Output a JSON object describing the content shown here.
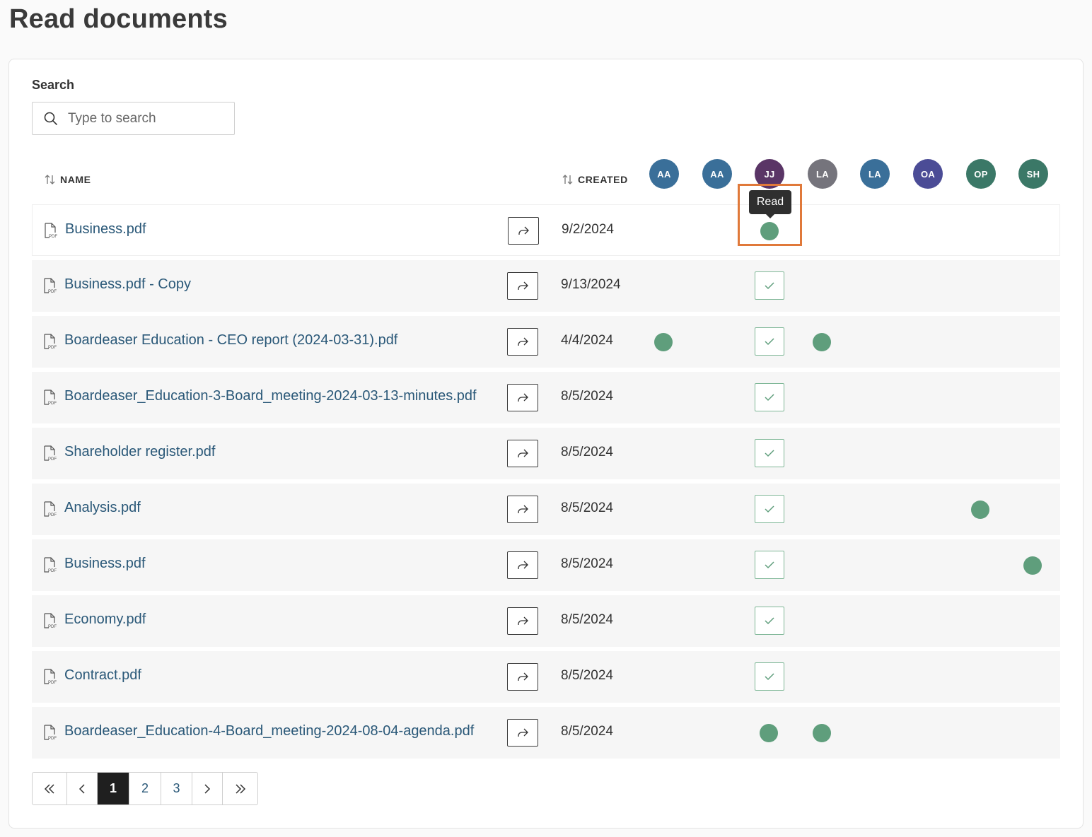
{
  "page": {
    "title": "Read documents"
  },
  "search": {
    "label": "Search",
    "placeholder": "Type to search",
    "value": ""
  },
  "columns": {
    "name": "NAME",
    "created": "CREATED"
  },
  "readers": [
    {
      "initials": "AA",
      "color": "#3a6f99"
    },
    {
      "initials": "AA",
      "color": "#3a6f99"
    },
    {
      "initials": "JJ",
      "color": "#5a3566"
    },
    {
      "initials": "LA",
      "color": "#75747c"
    },
    {
      "initials": "LA",
      "color": "#3a6f99"
    },
    {
      "initials": "OA",
      "color": "#4b4c96"
    },
    {
      "initials": "OP",
      "color": "#3b7867"
    },
    {
      "initials": "SH",
      "color": "#3b7867"
    }
  ],
  "tooltip": {
    "text": "Read"
  },
  "documents": [
    {
      "name": "Business.pdf",
      "created": "9/2/2024"
    },
    {
      "name": "Business.pdf - Copy",
      "created": "9/13/2024"
    },
    {
      "name": "Boardeaser Education - CEO report (2024-03-31).pdf",
      "created": "4/4/2024"
    },
    {
      "name": "Boardeaser_Education-3-Board_meeting-2024-03-13-minutes.pdf",
      "created": "8/5/2024"
    },
    {
      "name": "Shareholder register.pdf",
      "created": "8/5/2024"
    },
    {
      "name": "Analysis.pdf",
      "created": "8/5/2024"
    },
    {
      "name": "Business.pdf",
      "created": "8/5/2024"
    },
    {
      "name": "Economy.pdf",
      "created": "8/5/2024"
    },
    {
      "name": "Contract.pdf",
      "created": "8/5/2024"
    },
    {
      "name": "Boardeaser_Education-4-Board_meeting-2024-08-04-agenda.pdf",
      "created": "8/5/2024"
    }
  ],
  "pagination": {
    "first": "«",
    "prev": "‹",
    "pages": [
      "1",
      "2",
      "3"
    ],
    "current": "1",
    "next": "›",
    "last": "»"
  },
  "colors": {
    "read_dot": "#5f9e7c",
    "link": "#2a5878",
    "highlight": "#e0793a"
  }
}
